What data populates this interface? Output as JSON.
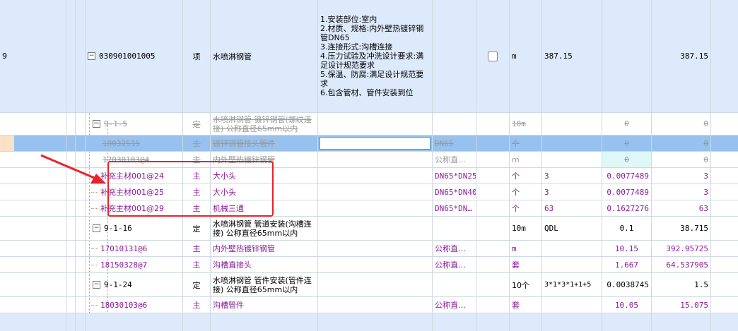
{
  "rows": [
    {
      "seq": "9",
      "code": "030901001005",
      "type": "项",
      "name": "水喷淋钢管",
      "desc": [
        "1.安装部位:室内",
        "2.材质、规格:内外壁热镀锌钢管DN65",
        "3.连接形式:沟槽连接",
        "4.压力试验及冲洗设计要求:满足设计规范要求",
        "5.保温、防腐:满足设计规范要求",
        "6.包含管材、管件安装到位"
      ],
      "unit": "m",
      "expr": "387.15",
      "qty": "",
      "total": "387.15"
    },
    {
      "seq": "",
      "code": "9-1-5",
      "type": "定",
      "name": "水喷淋钢管 镀锌钢管(螺纹连接) 公称直径65mm以内",
      "spec": "",
      "unit": "10m",
      "expr": "",
      "qty": "0",
      "total": "0"
    },
    {
      "seq": "",
      "code": "18032515",
      "type": "主",
      "name": "镀锌钢管接头管件",
      "spec": "DN65",
      "unit": "个",
      "expr": "",
      "qty": "0",
      "total": "0"
    },
    {
      "seq": "",
      "code": "17030103@4",
      "type": "主",
      "name": "内外壁热镀锌钢管",
      "spec": "公称直…",
      "unit": "m",
      "expr": "",
      "qty": "0",
      "total": "0"
    },
    {
      "seq": "",
      "code": "补充主材001@24",
      "type": "主",
      "name": "大小头",
      "spec": "DN65*DN25",
      "unit": "个",
      "expr": "3",
      "qty": "0.0077489",
      "total": "3"
    },
    {
      "seq": "",
      "code": "补充主材001@25",
      "type": "主",
      "name": "大小头",
      "spec": "DN65*DN40",
      "unit": "个",
      "expr": "3",
      "qty": "0.0077489",
      "total": "3"
    },
    {
      "seq": "",
      "code": "补充主材001@29",
      "type": "主",
      "name": "机械三通",
      "spec": "DN65*DN…",
      "unit": "个",
      "expr": "63",
      "qty": "0.1627276",
      "total": "63"
    },
    {
      "seq": "",
      "code": "9-1-16",
      "type": "定",
      "name": "水喷淋钢管 管道安装(沟槽连接) 公称直径65mm以内",
      "spec": "",
      "unit": "10m",
      "expr": "QDL",
      "qty": "0.1",
      "total": "38.715"
    },
    {
      "seq": "",
      "code": "17010131@6",
      "type": "主",
      "name": "内外壁热镀锌钢管",
      "spec": "公称直…",
      "unit": "m",
      "expr": "",
      "qty": "10.15",
      "total": "392.95725"
    },
    {
      "seq": "",
      "code": "18150328@7",
      "type": "主",
      "name": "沟槽直接头",
      "spec": "公称直…",
      "unit": "套",
      "expr": "",
      "qty": "1.667",
      "total": "64.537905"
    },
    {
      "seq": "",
      "code": "9-1-24",
      "type": "定",
      "name": "水喷淋钢管 管件安装(管件连接) 公称直径65mm以内",
      "spec": "",
      "unit": "10个",
      "expr": "3*1*3*1+1+5",
      "qty": "0.0038745",
      "total": "1.5"
    },
    {
      "seq": "",
      "code": "18030103@6",
      "type": "主",
      "name": "沟槽管件",
      "spec": "公称直…",
      "unit": "套",
      "expr": "",
      "qty": "10.05",
      "total": "15.075"
    }
  ],
  "colors": {
    "accent_red": "#e8232a",
    "row_blue": "#ddeafb",
    "row_selected": "#97c1ee",
    "sub_purple": "#8b1a9a"
  },
  "icons": {
    "expander": "minus-box-icon",
    "arrow": "red-arrow-annotation"
  }
}
